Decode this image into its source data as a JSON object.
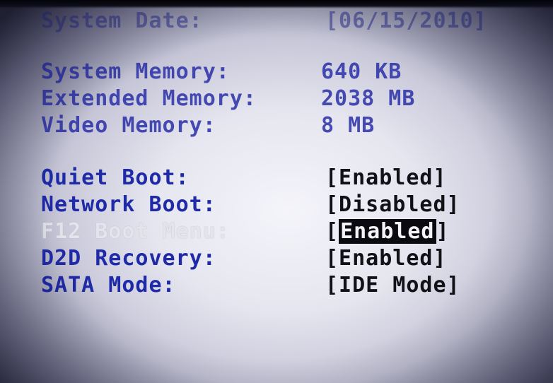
{
  "bios": {
    "system_date": {
      "label": "System Date:",
      "value": "[06/15/2010]"
    },
    "memory": [
      {
        "label": "System Memory:",
        "value": "640 KB"
      },
      {
        "label": "Extended Memory:",
        "value": "2038 MB"
      },
      {
        "label": "Video Memory:",
        "value": "8 MB"
      }
    ],
    "settings": [
      {
        "label": "Quiet Boot:",
        "value": "[Enabled]"
      },
      {
        "label": "Network Boot:",
        "value": "[Disabled]"
      },
      {
        "label": "F12 Boot Menu:",
        "value_open": "[",
        "value_selected": "Enabled",
        "value_close": "]"
      },
      {
        "label": "D2D Recovery:",
        "value": "[Enabled]"
      },
      {
        "label": "SATA Mode:",
        "value": "[IDE Mode]"
      }
    ]
  }
}
